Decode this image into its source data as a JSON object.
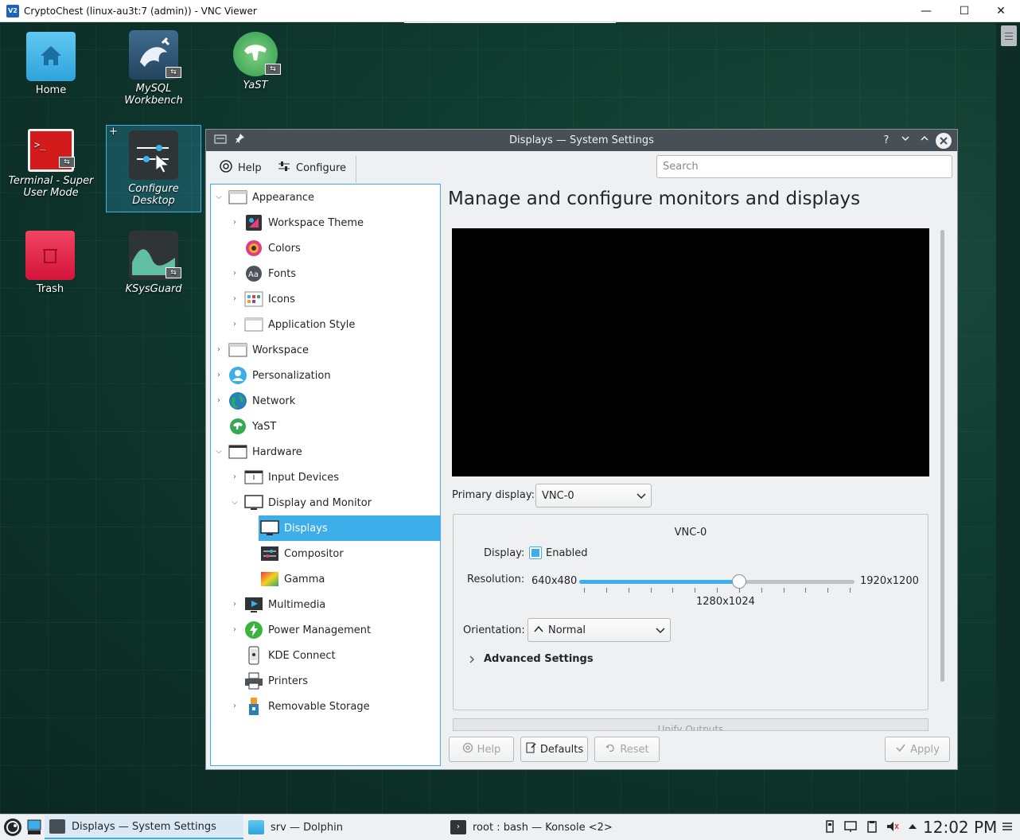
{
  "vnc": {
    "title": "CryptoChest (linux-au3t:7 (admin)) - VNC Viewer",
    "logo": "V2",
    "minimize": "—",
    "maximize": "☐",
    "close": "✕"
  },
  "desktop": {
    "icons": [
      {
        "label": "Home"
      },
      {
        "label": "MySQL Workbench"
      },
      {
        "label": "YaST"
      },
      {
        "label": "Terminal - Super User Mode"
      },
      {
        "label": "Configure Desktop"
      },
      {
        "label": "Trash"
      },
      {
        "label": "KSysGuard"
      }
    ]
  },
  "window": {
    "title": "Displays — System Settings",
    "help_glyph": "?",
    "toolbar": {
      "help": "Help",
      "configure": "Configure",
      "search_placeholder": "Search"
    },
    "sidebar": {
      "items": [
        {
          "label": "Appearance"
        },
        {
          "label": "Workspace Theme"
        },
        {
          "label": "Colors"
        },
        {
          "label": "Fonts"
        },
        {
          "label": "Icons"
        },
        {
          "label": "Application Style"
        },
        {
          "label": "Workspace"
        },
        {
          "label": "Personalization"
        },
        {
          "label": "Network"
        },
        {
          "label": "YaST"
        },
        {
          "label": "Hardware"
        },
        {
          "label": "Input Devices"
        },
        {
          "label": "Display and Monitor"
        },
        {
          "label": "Displays"
        },
        {
          "label": "Compositor"
        },
        {
          "label": "Gamma"
        },
        {
          "label": "Multimedia"
        },
        {
          "label": "Power Management"
        },
        {
          "label": "KDE Connect"
        },
        {
          "label": "Printers"
        },
        {
          "label": "Removable Storage"
        }
      ]
    },
    "content": {
      "title": "Manage and configure monitors and displays",
      "primary_label": "Primary display:",
      "primary_value": "VNC-0",
      "output_name": "VNC-0",
      "display_label": "Display:",
      "enabled_label": "Enabled",
      "enabled": true,
      "resolution_label": "Resolution:",
      "res_min": "640x480",
      "res_max": "1920x1200",
      "res_current": "1280x1024",
      "slider_fraction": 0.58,
      "slider_ticks": 13,
      "orientation_label": "Orientation:",
      "orientation_value": "Normal",
      "orientation_glyph": "^",
      "advanced_label": "Advanced Settings",
      "unify_label": "Unify Outputs"
    },
    "buttons": {
      "help": "Help",
      "defaults": "Defaults",
      "reset": "Reset",
      "apply": "Apply"
    }
  },
  "taskbar": {
    "tasks": [
      {
        "label": "Displays — System Settings"
      },
      {
        "label": "srv — Dolphin"
      },
      {
        "label": "root : bash — Konsole <2>"
      }
    ],
    "clock": "12:02 PM"
  },
  "colors": {
    "accent": "#3daee9",
    "titlebar": "#475057",
    "window_bg": "#eff0f1"
  }
}
